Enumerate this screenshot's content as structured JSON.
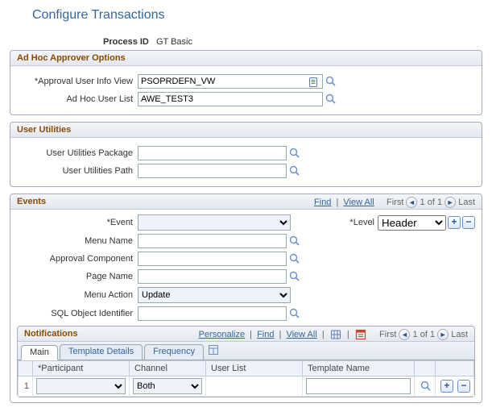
{
  "title": "Configure Transactions",
  "process_id": {
    "label": "Process ID",
    "value": "GT Basic"
  },
  "adhoc": {
    "header": "Ad Hoc Approver Options",
    "view": {
      "label": "*Approval User Info View",
      "value": "PSOPRDEFN_VW"
    },
    "userlist": {
      "label": "Ad Hoc User List",
      "value": "AWE_TEST3"
    }
  },
  "userutil": {
    "header": "User Utilities",
    "pkg": {
      "label": "User Utilities Package",
      "value": ""
    },
    "path": {
      "label": "User Utilities Path",
      "value": ""
    }
  },
  "events": {
    "header": "Events",
    "links": {
      "find": "Find",
      "view_all": "View All",
      "first": "First",
      "count": "1 of 1",
      "last": "Last"
    },
    "level": {
      "label": "*Level",
      "value": "Header",
      "options": [
        "Header"
      ]
    },
    "event": {
      "label": "*Event",
      "value": "",
      "options": [
        ""
      ]
    },
    "menu_name": {
      "label": "Menu Name",
      "value": ""
    },
    "component": {
      "label": "Approval Component",
      "value": ""
    },
    "page": {
      "label": "Page Name",
      "value": ""
    },
    "action": {
      "label": "Menu Action",
      "value": "Update",
      "options": [
        "Update"
      ]
    },
    "sql": {
      "label": "SQL Object Identifier",
      "value": ""
    }
  },
  "notifications": {
    "header": "Notifications",
    "links": {
      "personalize": "Personalize",
      "find": "Find",
      "view_all": "View All",
      "first": "First",
      "count": "1 of 1",
      "last": "Last"
    },
    "tabs": [
      "Main",
      "Template Details",
      "Frequency"
    ],
    "columns": {
      "participant": "*Participant",
      "channel": "Channel",
      "userlist": "User List",
      "template": "Template Name"
    },
    "rows": [
      {
        "num": "1",
        "participant": "",
        "channel": "Both",
        "userlist": "",
        "template": ""
      }
    ]
  }
}
